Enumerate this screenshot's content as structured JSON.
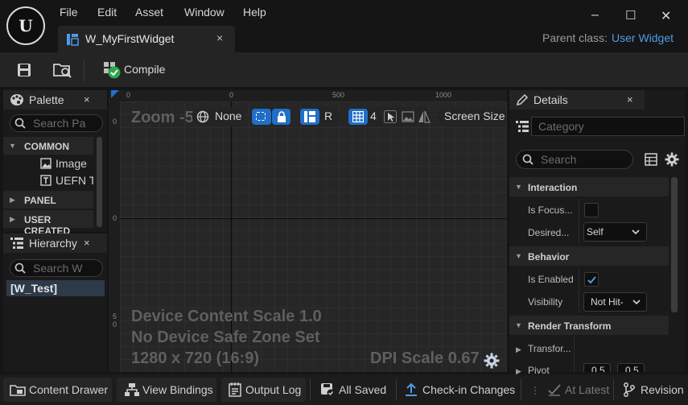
{
  "menu": [
    "File",
    "Edit",
    "Asset",
    "Window",
    "Help"
  ],
  "tab": {
    "label": "W_MyFirstWidget",
    "close": "×"
  },
  "window": {
    "minimize": "–",
    "maximize": "☐",
    "close": "✕"
  },
  "parent_class": {
    "label": "Parent class:",
    "value": "User Widget"
  },
  "toolbar": {
    "compile_label": "Compile"
  },
  "palette": {
    "title": "Palette",
    "close": "×",
    "search_placeholder": "Search Pa",
    "categories": [
      {
        "label": "COMMON",
        "items": [
          {
            "label": "Image"
          },
          {
            "label": "UEFN To"
          }
        ]
      },
      {
        "label": "PANEL"
      },
      {
        "label": "USER CREATED"
      }
    ]
  },
  "hierarchy": {
    "title": "Hierarchy",
    "close": "×",
    "search_placeholder": "Search W",
    "root": "[W_Test]"
  },
  "viewport": {
    "ruler_labels": [
      "0",
      "500",
      "1000"
    ],
    "left_ruler": [
      "0",
      "0",
      "5",
      "0"
    ],
    "zoom": "Zoom -5",
    "none_label": "None",
    "r_label": "R",
    "grid_value": "4",
    "screen_size": "Screen Size",
    "overlay": [
      "Device Content Scale 1.0",
      "No Device Safe Zone Set",
      "1280 x 720 (16:9)"
    ],
    "dpi": "DPI Scale 0.67"
  },
  "details": {
    "title": "Details",
    "close": "×",
    "category_placeholder": "Category",
    "search_placeholder": "Search",
    "sections": [
      {
        "label": "Interaction",
        "props": [
          {
            "label": "Is Focus..."
          },
          {
            "label": "Desired...",
            "value": "Self"
          }
        ]
      },
      {
        "label": "Behavior",
        "props": [
          {
            "label": "Is Enabled"
          },
          {
            "label": "Visibility",
            "value": "Not Hit-"
          }
        ]
      },
      {
        "label": "Render Transform",
        "props": [
          {
            "label": "Transfor..."
          },
          {
            "label": "Pivot",
            "values": [
              "0.5",
              "0.5"
            ]
          }
        ]
      }
    ]
  },
  "status": {
    "content_drawer": "Content Drawer",
    "view_bindings": "View Bindings",
    "output_log": "Output Log",
    "all_saved": "All Saved",
    "checkin": "Check-in Changes",
    "at_latest": "At Latest",
    "revision": "Revision"
  },
  "colors": {
    "accent": "#1f6fc8",
    "link": "#4d9be6",
    "check": "#2aa84a"
  }
}
